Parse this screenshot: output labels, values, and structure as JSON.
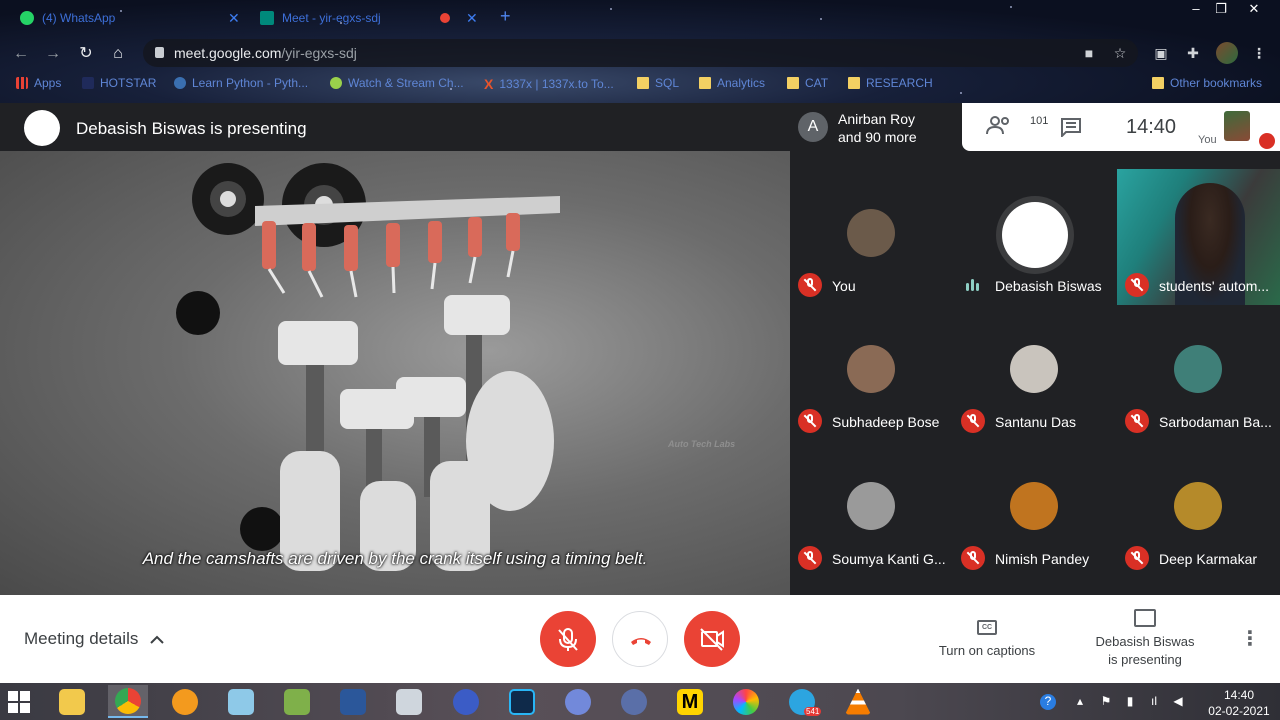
{
  "browser": {
    "tabs": [
      {
        "title": "(4) WhatsApp",
        "favicon_color": "#25d366"
      },
      {
        "title": "Meet - yir-egxs-sdj",
        "favicon_color": "#00897b"
      }
    ],
    "url_host": "meet.google.com",
    "url_path": "/yir-egxs-sdj",
    "bookmarks": [
      {
        "label": "Apps",
        "icon": "apps-grid-icon"
      },
      {
        "label": "HOTSTAR",
        "icon": "hotstar-icon"
      },
      {
        "label": "Learn Python - Pyth...",
        "icon": "python-icon"
      },
      {
        "label": "Watch & Stream Ch...",
        "icon": "stream-icon"
      },
      {
        "label": "1337x | 1337x.to To...",
        "icon": "x-logo-icon"
      },
      {
        "label": "SQL",
        "icon": "folder-icon"
      },
      {
        "label": "Analytics",
        "icon": "folder-icon"
      },
      {
        "label": "CAT",
        "icon": "folder-icon"
      },
      {
        "label": "RESEARCH",
        "icon": "folder-icon"
      },
      {
        "label": "Other bookmarks",
        "icon": "folder-icon"
      }
    ]
  },
  "meet": {
    "presenting_title": "Debasish Biswas is presenting",
    "subtitle": "And the camshafts are driven by the crank itself using a timing belt.",
    "watermark": "Auto Tech Labs",
    "people_strip": {
      "initial": "A",
      "line1": "Anirban Roy",
      "line2": "and 90 more"
    },
    "participants_count": "101",
    "clock": "14:40",
    "self_label": "You",
    "tiles": [
      {
        "name": "You",
        "state": "muted",
        "kind": "avatar",
        "color": "#6b5a4a"
      },
      {
        "name": "Debasish Biswas",
        "state": "speaking",
        "kind": "presenter"
      },
      {
        "name": "students' autom...",
        "state": "muted",
        "kind": "video"
      },
      {
        "name": "Subhadeep Bose",
        "state": "muted",
        "kind": "avatar",
        "color": "#8a6a55"
      },
      {
        "name": "Santanu Das",
        "state": "muted",
        "kind": "avatar",
        "color": "#c9c4bd"
      },
      {
        "name": "Sarbodaman Ba...",
        "state": "muted",
        "kind": "avatar",
        "color": "#3f7f78"
      },
      {
        "name": "Soumya Kanti G...",
        "state": "muted",
        "kind": "avatar",
        "color": "#9a9a9a"
      },
      {
        "name": "Nimish Pandey",
        "state": "muted",
        "kind": "avatar",
        "color": "#c0741f"
      },
      {
        "name": "Deep Karmakar",
        "state": "muted",
        "kind": "avatar",
        "color": "#b58a2a"
      }
    ],
    "bottom": {
      "meeting_details": "Meeting details",
      "captions": "Turn on captions",
      "presenting_line1": "Debasish Biswas",
      "presenting_line2": "is presenting"
    }
  },
  "taskbar": {
    "apps": [
      "file-explorer-icon",
      "chrome-icon",
      "fl-studio-icon",
      "notepad-icon",
      "excel-like-icon",
      "word-icon",
      "calculator-icon",
      "headphones-app-icon",
      "video-editor-icon",
      "discord-icon",
      "browser-arc-icon",
      "m-app-icon",
      "color-wheel-icon",
      "telegram-icon",
      "vlc-icon"
    ],
    "telegram_badge": "541",
    "time": "14:40",
    "date": "02-02-2021"
  },
  "colors": {
    "accent_red": "#ea4335",
    "mute_red": "#d93025",
    "meet_dark": "#202124"
  }
}
